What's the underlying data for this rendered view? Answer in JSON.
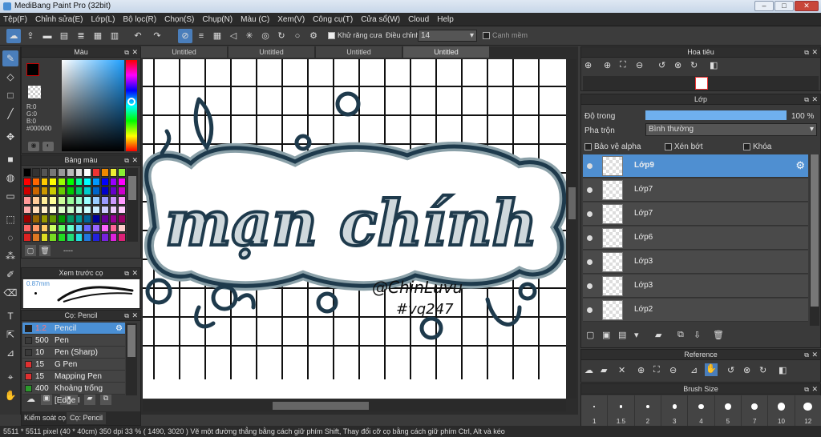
{
  "window": {
    "title": "MediBang Paint Pro (32bit)"
  },
  "menu": [
    "Tệp(F)",
    "Chỉnh sửa(E)",
    "Lớp(L)",
    "Bộ lọc(R)",
    "Chọn(S)",
    "Chụp(N)",
    "Màu (C)",
    "Xem(V)",
    "Công cụ(T)",
    "Cửa sổ(W)",
    "Cloud",
    "Help"
  ],
  "toolbar": {
    "antialias_label": "Khử răng cưa",
    "adjust_label": "Điều chỉnh",
    "adjust_value": "14",
    "snap_label": "Cạnh mềm"
  },
  "doc_tabs": [
    "Untitled",
    "Untitled",
    "Untitled",
    "Untitled"
  ],
  "color_panel": {
    "title": "Màu",
    "r": "R:0",
    "g": "G:0",
    "b": "B:0",
    "hex": "#000000"
  },
  "palette_panel": {
    "title": "Bảng màu",
    "footer": "----"
  },
  "brush_preview": {
    "title": "Xem trước cọ",
    "size": "0.87mm"
  },
  "brush_panel": {
    "title": "Cọ: Pencil",
    "brushes": [
      {
        "size": "1.2",
        "name": "Pencil",
        "color": "#222222"
      },
      {
        "size": "500",
        "name": "Pen",
        "color": "#3a3a3a"
      },
      {
        "size": "10",
        "name": "Pen (Sharp)",
        "color": "#3a3a3a"
      },
      {
        "size": "15",
        "name": "G Pen",
        "color": "#e03030"
      },
      {
        "size": "15",
        "name": "Mapping Pen",
        "color": "#e03030"
      },
      {
        "size": "400",
        "name": "Khoảng trống [Edge I",
        "color": "#2c9a2c"
      }
    ]
  },
  "left_bottom_tabs": [
    "Kiểm soát cọ",
    "Cọ: Pencil"
  ],
  "navigator": {
    "title": "Hoa tiêu"
  },
  "layers_panel": {
    "title": "Lớp",
    "opacity_label": "Độ trong",
    "opacity_value": "100 %",
    "opacity_fraction": 1.0,
    "blend_label": "Pha trộn",
    "blend_value": "Bình thường",
    "protect_alpha": "Bảo vệ alpha",
    "clipping": "Xén bớt",
    "lock": "Khóa",
    "layers": [
      "Lớp9",
      "Lớp7",
      "Lớp7",
      "Lớp6",
      "Lớp3",
      "Lớp3",
      "Lớp2"
    ]
  },
  "reference": {
    "title": "Reference"
  },
  "brush_size": {
    "title": "Brush Size",
    "sizes": [
      "1",
      "1.5",
      "2",
      "3",
      "4",
      "5",
      "7",
      "10",
      "12"
    ]
  },
  "artwork": {
    "title": "mạn chính",
    "sig1": "@ChinLuvu",
    "sig2": "#vq247"
  },
  "status": {
    "text": "5511 * 5511 pixel  (40 * 40cm)  350 dpi  33 %  ( 1490, 3020 )  Vẽ một đường thẳng bằng cách giữ phím Shift, Thay đổi cỡ cọ bằng cách giữ phím Ctrl, Alt và kéo"
  },
  "colors": {
    "accent": "#4a8fd4",
    "ink": "#1e3a4c",
    "ink_shadow": "#8aa0a8"
  }
}
